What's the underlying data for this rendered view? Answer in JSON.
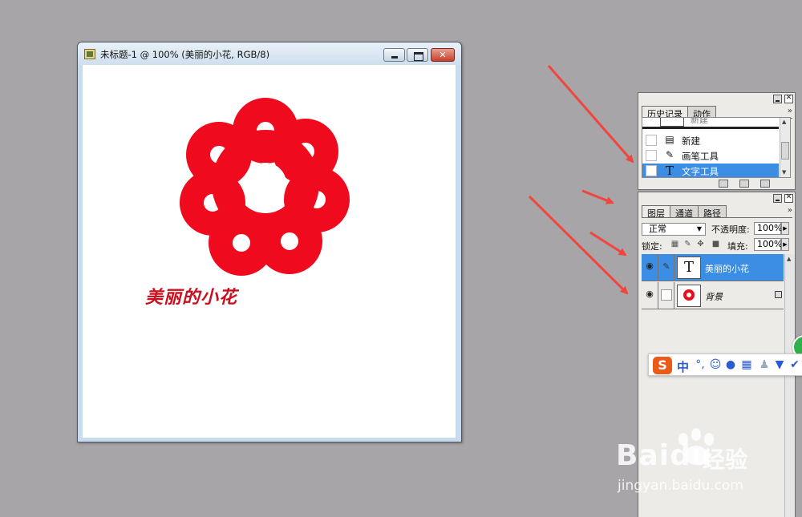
{
  "document": {
    "title": "未标题-1 @ 100% (美丽的小花, RGB/8)",
    "close_glyph": "✕",
    "canvas_text": "美丽的小花"
  },
  "history_panel": {
    "tabs": [
      "历史记录",
      "动作"
    ],
    "menu_glyph": "»",
    "snapshot_label": "新建",
    "items": [
      {
        "label": "新建",
        "icon": "document-icon",
        "selected": false
      },
      {
        "label": "画笔工具",
        "icon": "brush-icon",
        "selected": false
      },
      {
        "label": "文字工具",
        "icon": "type-tool-icon",
        "selected": true
      }
    ]
  },
  "layers_panel": {
    "tabs": [
      "图层",
      "通道",
      "路径"
    ],
    "menu_glyph": "»",
    "blend_mode": "正常",
    "opacity_label": "不透明度:",
    "opacity_value": "100%",
    "lock_label": "锁定:",
    "fill_label": "填充:",
    "fill_value": "100%",
    "layers": [
      {
        "name": "美丽的小花",
        "type": "text",
        "selected": true
      },
      {
        "name": "背景",
        "type": "image",
        "selected": false
      }
    ]
  },
  "ime_bar": {
    "logo": "S",
    "mode": "中"
  },
  "watermark": {
    "brand_latin": "Baidu",
    "brand_cn": "经验",
    "url": "jingyan.baidu.com"
  },
  "colors": {
    "flower_red": "#f00a1e",
    "text_red": "#c8111f",
    "selection_blue": "#3b8ee3",
    "arrow_red": "#f0463f",
    "workspace_gray": "#a7a5a7"
  }
}
